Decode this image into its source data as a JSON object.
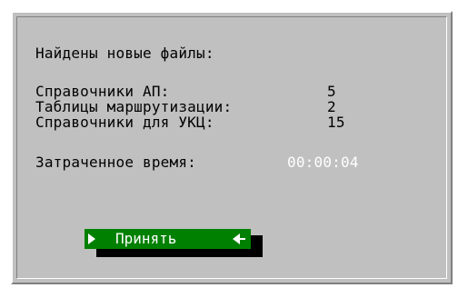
{
  "dialog": {
    "heading": "Найдены новые файлы:",
    "rows": [
      {
        "label": "Справочники АП:",
        "value": "5"
      },
      {
        "label": "Таблицы маршрутизации:",
        "value": "2"
      },
      {
        "label": "Справочники для УКЦ:",
        "value": "15"
      }
    ],
    "elapsed_label": "Затраченное время:",
    "elapsed_value": "00:00:04",
    "accept_button": {
      "label": "Принять"
    }
  },
  "colors": {
    "dialog_background": "#c0c0c0",
    "button_background": "#008000",
    "button_text": "#ffffff",
    "elapsed_value_text": "#ffffff"
  },
  "icons": [
    "arrow-right-icon",
    "arrow-left-icon"
  ]
}
